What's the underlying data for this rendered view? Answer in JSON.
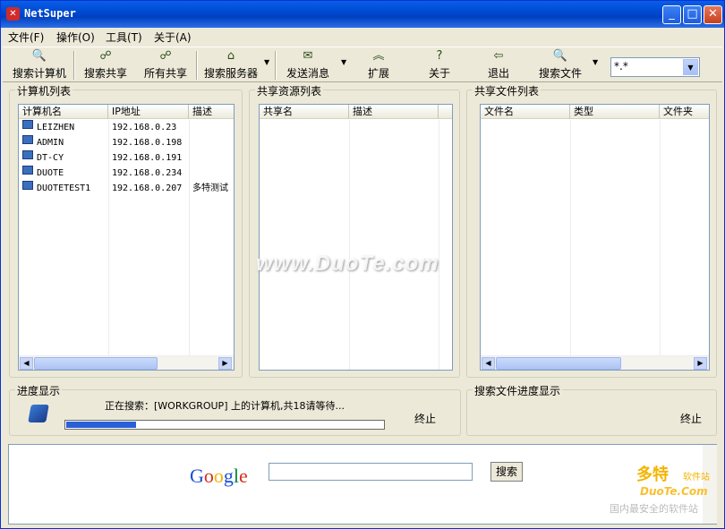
{
  "window": {
    "title": "NetSuper",
    "app_icon": "app-logo-icon"
  },
  "menu": [
    {
      "label": "文件(F)"
    },
    {
      "label": "操作(O)"
    },
    {
      "label": "工具(T)"
    },
    {
      "label": "关于(A)"
    }
  ],
  "toolbar": {
    "buttons": [
      {
        "label": "搜索计算机",
        "icon": "search-computer-icon"
      },
      {
        "label": "搜索共享",
        "icon": "search-share-icon"
      },
      {
        "label": "所有共享",
        "icon": "all-shares-icon"
      },
      {
        "label": "搜索服务器",
        "icon": "search-server-icon"
      },
      {
        "label": "发送消息",
        "icon": "send-message-icon"
      },
      {
        "label": "扩展",
        "icon": "expand-icon"
      },
      {
        "label": "关于",
        "icon": "help-icon"
      },
      {
        "label": "退出",
        "icon": "exit-icon"
      },
      {
        "label": "搜索文件",
        "icon": "search-file-icon"
      }
    ],
    "filter_combo_value": "*.*"
  },
  "computer_list": {
    "title": "计算机列表",
    "columns": [
      "计算机名",
      "IP地址",
      "描述"
    ],
    "rows": [
      {
        "name": "LEIZHEN",
        "ip": "192.168.0.23",
        "desc": ""
      },
      {
        "name": "ADMIN",
        "ip": "192.168.0.198",
        "desc": ""
      },
      {
        "name": "DT-CY",
        "ip": "192.168.0.191",
        "desc": ""
      },
      {
        "name": "DUOTE",
        "ip": "192.168.0.234",
        "desc": ""
      },
      {
        "name": "DUOTETEST1",
        "ip": "192.168.0.207",
        "desc": "多特测试"
      }
    ]
  },
  "share_list": {
    "title": "共享资源列表",
    "columns": [
      "共享名",
      "描述"
    ]
  },
  "file_list": {
    "title": "共享文件列表",
    "columns": [
      "文件名",
      "类型",
      "文件夹"
    ]
  },
  "progress": {
    "title": "进度显示",
    "status": "正在搜索：[WORKGROUP] 上的计算机,共18请等待...",
    "fraction": 0.22,
    "stop_label": "终止"
  },
  "file_progress": {
    "title": "搜索文件进度显示",
    "stop_label": "终止"
  },
  "web": {
    "google_logo": "Google",
    "search_button": "搜索"
  },
  "watermark": "www.DuoTe.com",
  "corner_logo": {
    "cn": "多特",
    "sub": "软件站",
    "en": "DuoTe.Com",
    "caption": "国内最安全的软件站"
  }
}
